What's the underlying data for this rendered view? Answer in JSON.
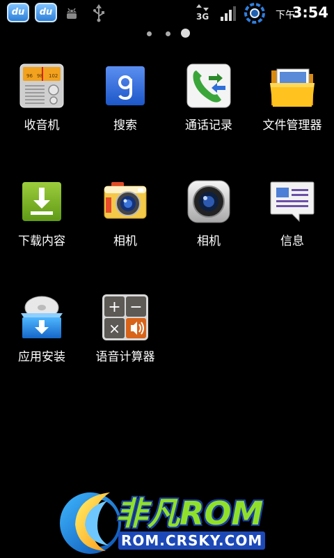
{
  "status_bar": {
    "left_icons": [
      "baidu-du-icon",
      "baidu-du-icon",
      "android-debug-icon",
      "usb-icon"
    ],
    "du_text": "du",
    "network_type": "3G",
    "signal_level": 0.75,
    "ampm": "下午",
    "time": "3:54"
  },
  "page_indicator": {
    "pages": 3,
    "active_index": 2
  },
  "apps": [
    {
      "label": "收音机",
      "icon": "radio-icon"
    },
    {
      "label": "搜索",
      "icon": "google-search-icon"
    },
    {
      "label": "通话记录",
      "icon": "call-log-icon"
    },
    {
      "label": "文件管理器",
      "icon": "file-manager-icon"
    },
    {
      "label": "下载内容",
      "icon": "downloads-icon"
    },
    {
      "label": "相机",
      "icon": "camera-icon"
    },
    {
      "label": "相机",
      "icon": "camera-icon"
    },
    {
      "label": "信息",
      "icon": "messaging-icon"
    },
    {
      "label": "应用安装",
      "icon": "app-installer-icon"
    },
    {
      "label": "语音计算器",
      "icon": "voice-calculator-icon"
    }
  ],
  "radio_dial": [
    "96",
    "98",
    "102"
  ],
  "calculator_keys": [
    "+",
    "−",
    "×"
  ],
  "watermark": {
    "brand": "非凡ROM",
    "url": "ROM.CRSKY.COM"
  }
}
